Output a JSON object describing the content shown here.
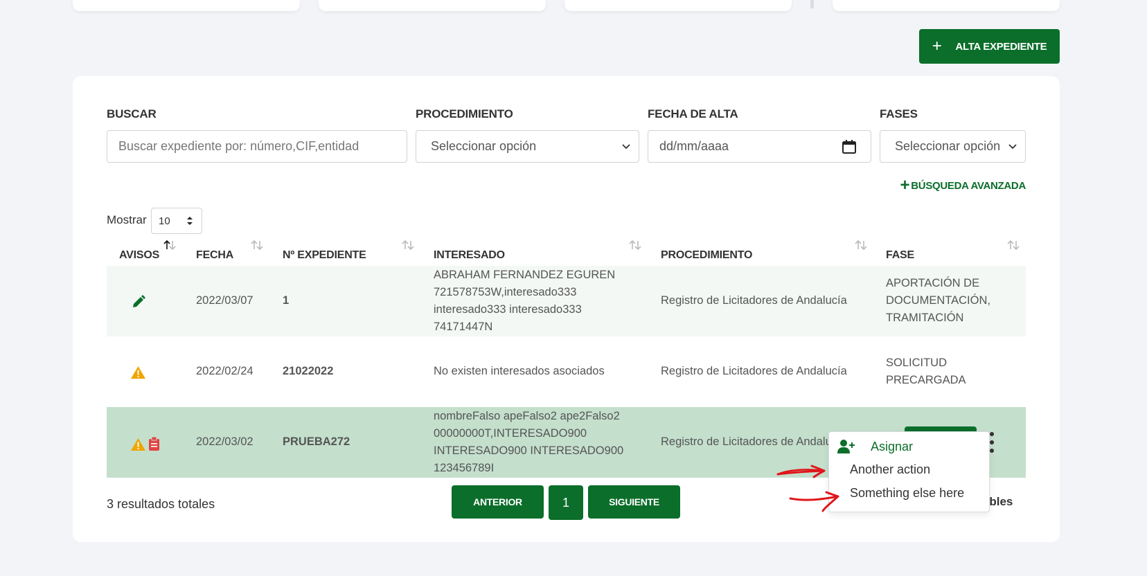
{
  "header": {
    "alta_label": "ALTA EXPEDIENTE"
  },
  "filters": {
    "buscar_label": "BUSCAR",
    "buscar_placeholder": "Buscar expediente por: número,CIF,entidad",
    "procedimiento_label": "PROCEDIMIENTO",
    "procedimiento_value": "Seleccionar opción",
    "fecha_label": "FECHA DE ALTA",
    "fecha_value": "dd/mm/aaaa",
    "fases_label": "FASES",
    "fases_value": "Seleccionar opción",
    "advanced_label": "BÚSQUEDA AVANZADA"
  },
  "mostrar": {
    "label": "Mostrar",
    "value": "10"
  },
  "table": {
    "headers": [
      "AVISOS",
      "FECHA",
      "Nº EXPEDIENTE",
      "INTERESADO",
      "PROCEDIMIENTO",
      "FASE"
    ],
    "rows": [
      {
        "avisos": [
          "pencil-icon"
        ],
        "fecha": "2022/03/07",
        "expediente": "1",
        "interesado": [
          "ABRAHAM FERNANDEZ EGUREN",
          "721578753W,interesado333",
          "interesado333 interesado333",
          "74171447N"
        ],
        "procedimiento": "Registro de Licitadores de Andalucía",
        "fase": [
          "APORTACIÓN DE",
          "DOCUMENTACIÓN,",
          "TRAMITACIÓN"
        ]
      },
      {
        "avisos": [
          "warning-icon"
        ],
        "fecha": "2022/02/24",
        "expediente": "21022022",
        "interesado": [
          "No existen interesados asociados"
        ],
        "procedimiento": "Registro de Licitadores de Andalucía",
        "fase": [
          "SOLICITUD",
          "PRECARGADA"
        ]
      },
      {
        "avisos": [
          "warning-icon",
          "clipboard-icon"
        ],
        "fecha": "2022/03/02",
        "expediente": "PRUEBA272",
        "interesado": [
          "nombreFalso apeFalso2 ape2Falso2",
          "00000000T,INTERESADO900",
          "INTERESADO900 INTERESADO900",
          "123456789I"
        ],
        "procedimiento": "Registro de Licitadores de Andalucía",
        "fase": []
      }
    ]
  },
  "footer": {
    "results": "3 resultados totales",
    "prev": "ANTERIOR",
    "page": "1",
    "next": "SIGUIENTE",
    "visibles": "visibles"
  },
  "dropdown": {
    "items": [
      "Asignar",
      "Another action",
      "Something else here"
    ]
  },
  "colors": {
    "accent": "#0b6e2a",
    "selected_row": "#c4dfcc",
    "striped_row": "#f3f8f4",
    "warning": "#f0a500",
    "danger": "#e04444"
  }
}
